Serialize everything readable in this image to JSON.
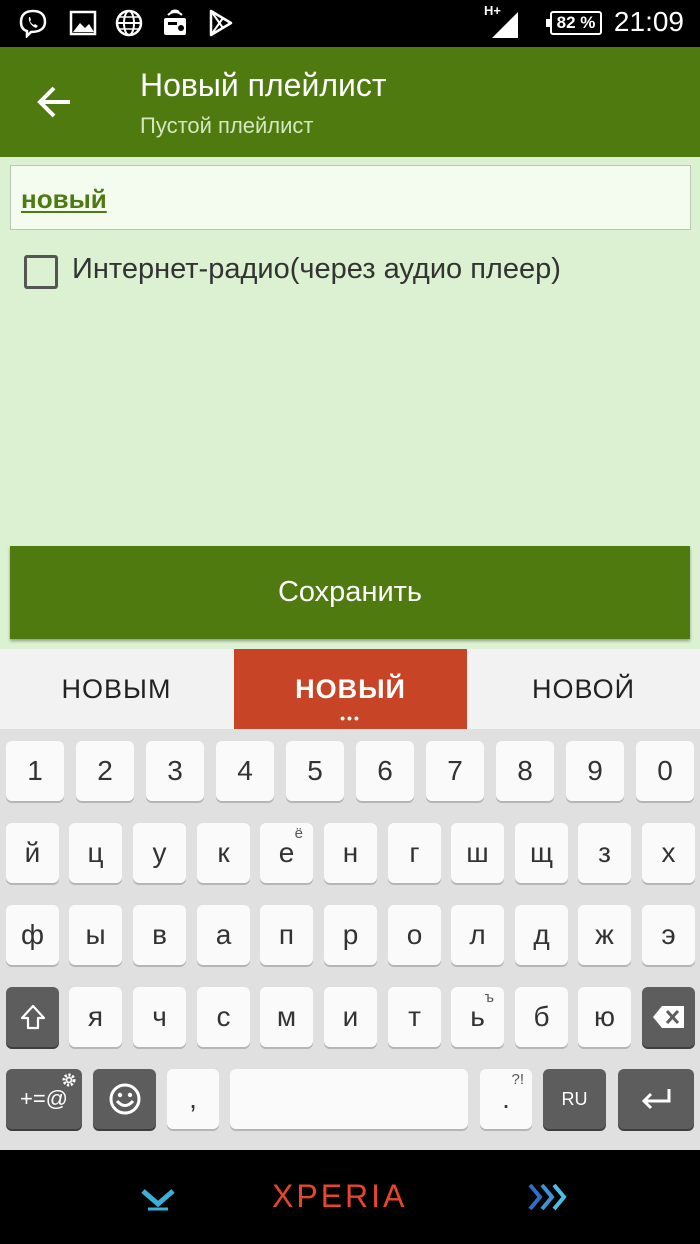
{
  "status_bar": {
    "time": "21:09",
    "battery": "82 %",
    "network": "H+",
    "icons": [
      "viber-icon",
      "image-icon",
      "globe-icon",
      "radio-icon",
      "play-store-icon",
      "signal-icon",
      "battery-icon"
    ]
  },
  "app_bar": {
    "title": "Новый плейлист",
    "subtitle": "Пустой плейлист",
    "color": "#4e7a10"
  },
  "form": {
    "name_value": "новый",
    "checkbox_label": "Интернет-радио(через аудио плеер)",
    "checkbox_checked": false,
    "save_label": "Сохранить",
    "background": "#dcf1d2"
  },
  "suggestions": {
    "items": [
      "НОВЫМ",
      "НОВЫЙ",
      "НОВОЙ"
    ],
    "selected": "НОВЫЙ",
    "more": "•••",
    "accent": "#c84426"
  },
  "keyboard": {
    "row_numbers": [
      "1",
      "2",
      "3",
      "4",
      "5",
      "6",
      "7",
      "8",
      "9",
      "0"
    ],
    "row1": [
      "й",
      "ц",
      "у",
      "к",
      "е",
      "н",
      "г",
      "ш",
      "щ",
      "з",
      "х"
    ],
    "row1_hint_e": "ё",
    "row2": [
      "ф",
      "ы",
      "в",
      "а",
      "п",
      "р",
      "о",
      "л",
      "д",
      "ж",
      "э"
    ],
    "row3": [
      "я",
      "ч",
      "с",
      "м",
      "и",
      "т",
      "ь",
      "б",
      "ю"
    ],
    "row3_hint_soft": "ъ",
    "symbols_label": "+=@",
    "comma": ",",
    "period": ".",
    "period_hint": "?!",
    "lang": "RU"
  },
  "nav_bar": {
    "brand": "XPERIA"
  }
}
